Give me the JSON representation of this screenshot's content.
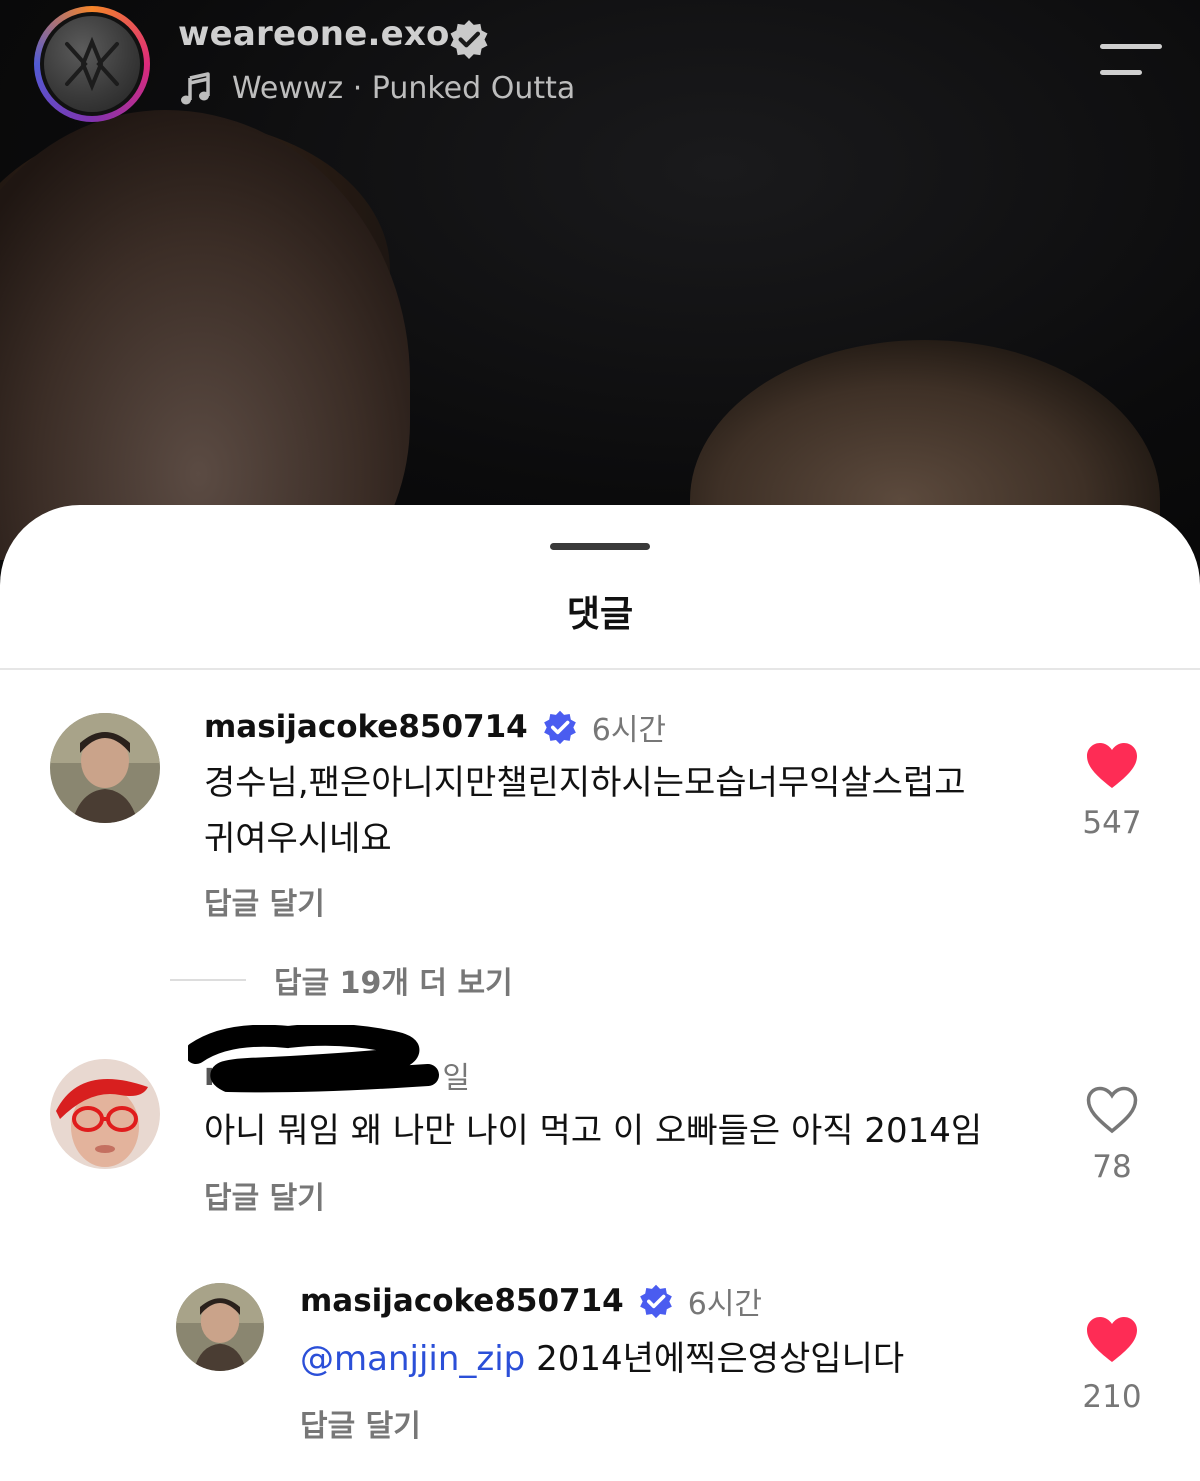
{
  "header": {
    "username": "weareone.exo",
    "music_text": "Wewwz · Punked Outta"
  },
  "sheet": {
    "title": "댓글"
  },
  "comments": [
    {
      "username": "masijacoke850714",
      "time": "6시간",
      "text_line1": "경수님,팬은아니지만챌린지하시는모습너무익살스럽고",
      "text_line2": "귀여우시네요",
      "reply_label": "답글 달기",
      "likes": "547",
      "liked": true,
      "verified": true
    },
    {
      "username_partial": "m",
      "time_partial": "일",
      "text": "아니 뭐임 왜 나만 나이 먹고 이 오빠들은 아직 2014임",
      "reply_label": "답글 달기",
      "likes": "78",
      "liked": false
    }
  ],
  "more_replies": "답글 19개 더 보기",
  "reply": {
    "username": "masijacoke850714",
    "time": "6시간",
    "mention": "@manjjin_zip",
    "text": " 2014년에찍은영상입니다",
    "reply_label": "답글 달기",
    "likes": "210",
    "liked": true,
    "verified": true
  },
  "colors": {
    "like_red": "#fe2c55",
    "verified_blue": "#4a5cf0",
    "mention_blue": "#2b4fd8"
  }
}
